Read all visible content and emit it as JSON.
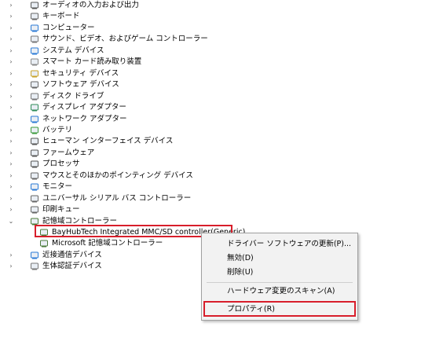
{
  "tree": {
    "items": [
      {
        "label": "オーディオの入力および出力",
        "icon": "speaker-icon",
        "expanded": false
      },
      {
        "label": "キーボード",
        "icon": "keyboard-icon",
        "expanded": false
      },
      {
        "label": "コンピューター",
        "icon": "computer-icon",
        "expanded": false
      },
      {
        "label": "サウンド、ビデオ、およびゲーム コントローラー",
        "icon": "sound-icon",
        "expanded": false
      },
      {
        "label": "システム デバイス",
        "icon": "system-device-icon",
        "expanded": false
      },
      {
        "label": "スマート カード読み取り装置",
        "icon": "smart-card-icon",
        "expanded": false
      },
      {
        "label": "セキュリティ デバイス",
        "icon": "security-icon",
        "expanded": false
      },
      {
        "label": "ソフトウェア デバイス",
        "icon": "software-device-icon",
        "expanded": false
      },
      {
        "label": "ディスク ドライブ",
        "icon": "disk-drive-icon",
        "expanded": false
      },
      {
        "label": "ディスプレイ アダプター",
        "icon": "display-adapter-icon",
        "expanded": false
      },
      {
        "label": "ネットワーク アダプター",
        "icon": "network-adapter-icon",
        "expanded": false
      },
      {
        "label": "バッテリ",
        "icon": "battery-icon",
        "expanded": false
      },
      {
        "label": "ヒューマン インターフェイス デバイス",
        "icon": "hid-icon",
        "expanded": false
      },
      {
        "label": "ファームウェア",
        "icon": "firmware-icon",
        "expanded": false
      },
      {
        "label": "プロセッサ",
        "icon": "processor-icon",
        "expanded": false
      },
      {
        "label": "マウスとそのほかのポインティング デバイス",
        "icon": "mouse-icon",
        "expanded": false
      },
      {
        "label": "モニター",
        "icon": "monitor-icon",
        "expanded": false
      },
      {
        "label": "ユニバーサル シリアル バス コントローラー",
        "icon": "usb-icon",
        "expanded": false
      },
      {
        "label": "印刷キュー",
        "icon": "printer-icon",
        "expanded": false
      },
      {
        "label": "記憶域コントローラー",
        "icon": "storage-controller-icon",
        "expanded": true
      },
      {
        "label": "BayHubTech Integrated MMC/SD controller(Generic)",
        "icon": "storage-controller-icon",
        "child": true
      },
      {
        "label": "Microsoft 記憶域コントローラー",
        "icon": "storage-controller-icon",
        "child": true
      },
      {
        "label": "近接通信デバイス",
        "icon": "proximity-icon",
        "expanded": false
      },
      {
        "label": "生体認証デバイス",
        "icon": "biometric-icon",
        "expanded": false
      }
    ]
  },
  "context_menu": {
    "items": [
      {
        "label": "ドライバー ソフトウェアの更新(P)..."
      },
      {
        "label": "無効(D)"
      },
      {
        "label": "削除(U)"
      },
      {
        "label": "ハードウェア変更のスキャン(A)"
      },
      {
        "label": "プロパティ(R)"
      }
    ]
  },
  "colors": {
    "highlight_border": "#d81e2b",
    "menu_background": "#f2f2f2"
  }
}
